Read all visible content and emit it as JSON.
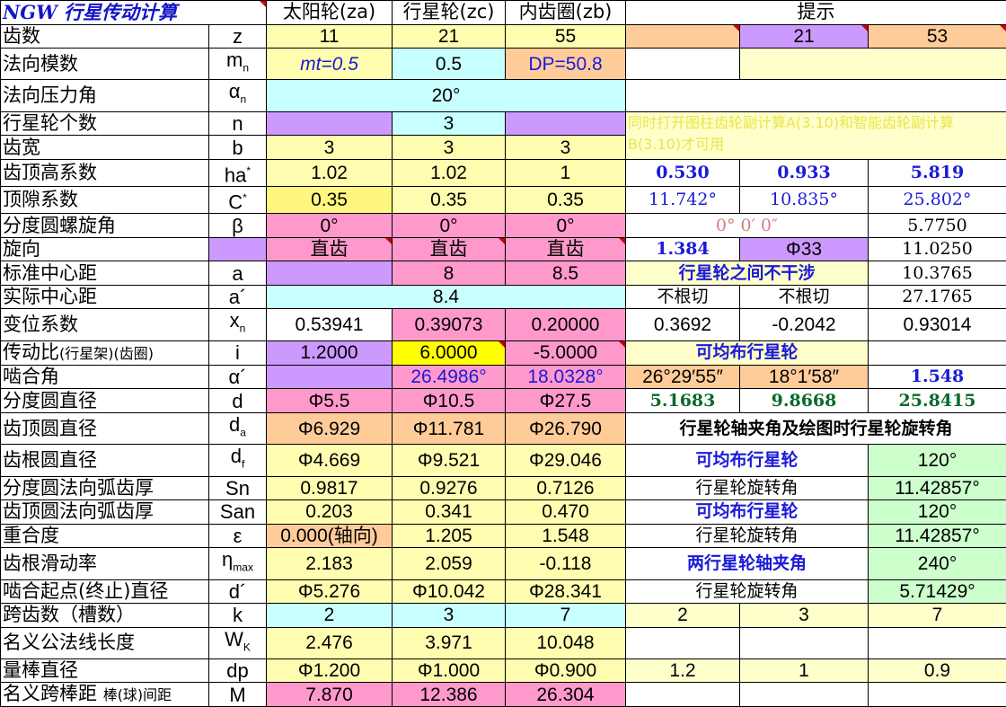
{
  "title": "NGW 行星传动计算",
  "headers": {
    "sun": "太阳轮(za)",
    "planet": "行星轮(zc)",
    "ring": "内齿圈(zb)",
    "hint": "提示"
  },
  "rows": {
    "teeth": {
      "label": "齿数",
      "sym": "z",
      "sun": "11",
      "planet": "21",
      "ring": "55",
      "h2": "21",
      "h3": "53"
    },
    "mn": {
      "label": "法向模数",
      "sym": "m",
      "sub": "n",
      "sun": "mt=0.5",
      "planet": "0.5",
      "ring": "DP=50.8"
    },
    "alpha": {
      "label": "法向压力角",
      "sym": "α",
      "sub": "n",
      "value": "20°"
    },
    "np": {
      "label": "行星轮个数",
      "sym": "n",
      "planet": "3"
    },
    "b": {
      "label": "齿宽",
      "sym": "b",
      "sun": "3",
      "planet": "3",
      "ring": "3"
    },
    "ha": {
      "label": "齿顶高系数",
      "sym": "ha",
      "sup": "*",
      "sun": "1.02",
      "planet": "1.02",
      "ring": "1",
      "h1": "0.530",
      "h2": "0.933",
      "h3": "5.819"
    },
    "c": {
      "label": "顶隙系数",
      "sym": "C",
      "sup": "*",
      "sun": "0.35",
      "planet": "0.35",
      "ring": "0.35",
      "h1": "11.742°",
      "h2": "10.835°",
      "h3": "25.802°"
    },
    "beta": {
      "label": "分度圆螺旋角",
      "sym": "β",
      "sun": "0°",
      "planet": "0°",
      "ring": "0°",
      "h12": "0° 0′ 0″",
      "h3": "5.7750"
    },
    "dir": {
      "label": "旋向",
      "planet": "直齿",
      "ring": "直齿",
      "sun": "直齿",
      "h1": "1.384",
      "h2": "Φ33",
      "h3": "11.0250"
    },
    "a": {
      "label": "标准中心距",
      "sym": "a",
      "planet": "8",
      "ring": "8.5",
      "h12": "行星轮之间不干涉",
      "h3": "10.3765"
    },
    "a2": {
      "label": "实际中心距",
      "sym": "a´",
      "value": "8.4",
      "h1": "不根切",
      "h2": "不根切",
      "h3": "27.1765"
    },
    "x": {
      "label": "变位系数",
      "sym": "x",
      "sub": "n",
      "sun": "0.53941",
      "planet": "0.39073",
      "ring": "0.20000",
      "h1": "0.3692",
      "h2": "-0.2042",
      "h3": "0.93014"
    },
    "i": {
      "label": "传动比",
      "label2": "(行星架)(齿圈)",
      "sym": "i",
      "sun": "1.2000",
      "planet": "6.0000",
      "ring": "-5.0000",
      "h12": "可均布行星轮"
    },
    "mesh": {
      "label": "啮合角",
      "sym": "α´",
      "planet": "26.4986°",
      "ring": "18.0328°",
      "h1": "26°29′55″",
      "h2": "18°1′58″",
      "h3": "1.548"
    },
    "d": {
      "label": "分度圆直径",
      "sym": "d",
      "sun": "Φ5.5",
      "planet": "Φ10.5",
      "ring": "Φ27.5",
      "h1": "5.1683",
      "h2": "9.8668",
      "h3": "25.8415"
    },
    "da": {
      "label": "齿顶圆直径",
      "sym": "d",
      "sub": "a",
      "sun": "Φ6.929",
      "planet": "Φ11.781",
      "ring": "Φ26.790",
      "h123": "行星轮轴夹角及绘图时行星轮旋转角"
    },
    "df": {
      "label": "齿根圆直径",
      "sym": "d",
      "sub": "f",
      "sun": "Φ4.669",
      "planet": "Φ9.521",
      "ring": "Φ29.046",
      "h12": "可均布行星轮",
      "h3": "120°"
    },
    "sn": {
      "label": "分度圆法向弧齿厚",
      "sym": "Sn",
      "sun": "0.9817",
      "planet": "0.9276",
      "ring": "0.7126",
      "h12": "行星轮旋转角",
      "h3": "11.42857°"
    },
    "san": {
      "label": "齿顶圆法向弧齿厚",
      "sym": "San",
      "sun": "0.203",
      "planet": "0.341",
      "ring": "0.470",
      "h12": "可均布行星轮",
      "h3": "120°"
    },
    "eps": {
      "label": "重合度",
      "sym": "ε",
      "sun": "0.000(轴向)",
      "planet": "1.205",
      "ring": "1.548",
      "h12": "行星轮旋转角",
      "h3": "11.42857°"
    },
    "eta": {
      "label": "齿根滑动率",
      "sym": "η",
      "sub": "max",
      "sun": "2.183",
      "planet": "2.059",
      "ring": "-0.118",
      "h12": "两行星轮轴夹角",
      "h3": "240°"
    },
    "dstart": {
      "label": "啮合起点(终止)直径",
      "sym": "d´",
      "sun": "Φ5.276",
      "planet": "Φ10.042",
      "ring": "Φ28.341",
      "h12": "行星轮旋转角",
      "h3": "5.71429°"
    },
    "k": {
      "label": "跨齿数（槽数）",
      "sym": "k",
      "sun": "2",
      "planet": "3",
      "ring": "7",
      "h1": "2",
      "h2": "3",
      "h3": "7"
    },
    "wk": {
      "label": "名义公法线长度",
      "sym": "W",
      "sub": "K",
      "sun": "2.476",
      "planet": "3.971",
      "ring": "10.048"
    },
    "dp": {
      "label": "量棒直径",
      "sym": "dp",
      "sun": "Φ1.200",
      "planet": "Φ1.000",
      "ring": "Φ0.900",
      "h1": "1.2",
      "h2": "1",
      "h3": "0.9"
    },
    "m": {
      "label": "名义跨棒距",
      "label2": "棒(球)间距",
      "sym": "M",
      "sun": "7.870",
      "planet": "12.386",
      "ring": "26.304"
    }
  },
  "note": "同时打开图柱齿轮副计算A(3.10)和智能齿轮副计算B(3.10)才可用",
  "colors": {
    "title": "#1515c8",
    "yellow": "#fffdb0",
    "cyan": "#c8ffff",
    "pink": "#ff99cc",
    "lavender": "#cc99ff",
    "orange": "#ffcc99",
    "green": "#ccffcc"
  }
}
